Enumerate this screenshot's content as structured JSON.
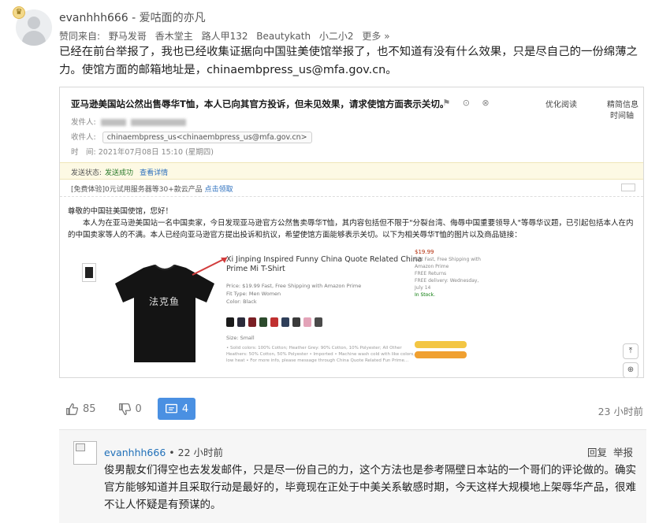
{
  "comment": {
    "username": "evanhhh666",
    "separator": " - ",
    "motto": "爱咕面的亦凡",
    "liked_prefix": "赞同来自:",
    "liked_users": [
      "野马发哥",
      "香木堂主",
      "路人甲132",
      "Beautykath",
      "小二小2"
    ],
    "liked_more": "更多 »",
    "text": "已经在前台举报了，我也已经收集证据向中国驻美使馆举报了，也不知道有没有什么效果，只是尽自己的一份绵薄之力。使馆方面的邮箱地址是，chinaembpress_us@mfa.gov.cn。"
  },
  "email": {
    "subject": "亚马逊美国站公然出售辱华T恤，本人已向其官方投诉，但未见效果，请求使馆方面表示关切。",
    "tools": "☆ ⚑ ⊙ ⊗",
    "optimize_label": "优化阅读",
    "detail_label": "精简信息",
    "from_label": "发件人:",
    "to_label": "收件人:",
    "to_value": "chinaembpress_us<chinaembpress_us@mfa.gov.cn>",
    "time_label": "时　间:",
    "time_value": "2021年07月08日 15:10 (星期四)",
    "timeline_label": "时间轴",
    "status_label": "发送状态:",
    "status_value": "发送成功",
    "status_link": "查看详情",
    "promo_text": "[免费体验]0元试用服务器等30+款云产品",
    "promo_link": "点击领取",
    "greeting": "尊敬的中国驻美国使馆，您好！",
    "body": "本人为在亚马逊美国站一名中国卖家，今日发现亚马逊官方公然售卖辱华T恤，其内容包括但不限于\"分裂台湾、侮辱中国重要领导人\"等辱华议题，已引起包括本人在内的中国卖家等人的不满。本人已经向亚马逊官方提出投诉和抗议，希望使馆方面能够表示关切。以下为相关辱华T恤的图片以及商品链接：",
    "product_title": "Xi Jinping Inspired Funny China Quote Related China Prime Mi T-Shirt",
    "shirt_print": "法克鱼",
    "price_line": "Price: $19.99 Fast, Free Shipping with Amazon Prime",
    "fit_line": "Fit Type: Men  Women",
    "color_line": "Color: Black",
    "size_line": "Size: Small",
    "bullets": "• Solid colors: 100% Cotton; Heather Grey: 90% Cotton, 10% Polyester; All Other Heathers: 50% Cotton, 50% Polyester  • Imported  • Machine wash cold with like colors, dry low heat  • For more info, please message through China Quote Related Fun Prime...",
    "buybox_price": "$19.99",
    "buybox_line1": "Get Fast, Free Shipping with Amazon Prime",
    "buybox_line2": "FREE Returns",
    "buybox_line3": "FREE delivery: Wednesday, July 14",
    "buybox_line4": "In Stock."
  },
  "actions": {
    "like_count": "85",
    "dislike_count": "0",
    "reply_count": "4",
    "time": "23 小时前"
  },
  "reply": {
    "username": "evanhhh666",
    "time": " • 22 小时前",
    "reply_label": "回复",
    "report_label": "举报",
    "text": "俊男靓女们得空也去发发邮件，只是尽一份自己的力，这个方法也是参考隔壁日本站的一个哥们的评论做的。确实官方能够知道并且采取行动是最好的，毕竟现在正处于中美关系敏感时期，今天这样大规模地上架辱华产品，很难不让人怀疑是有预谋的。"
  },
  "colors": {
    "link_blue": "#1f6fb8",
    "reply_button": "#4a90e2",
    "status_bg": "#fdf9e4"
  }
}
